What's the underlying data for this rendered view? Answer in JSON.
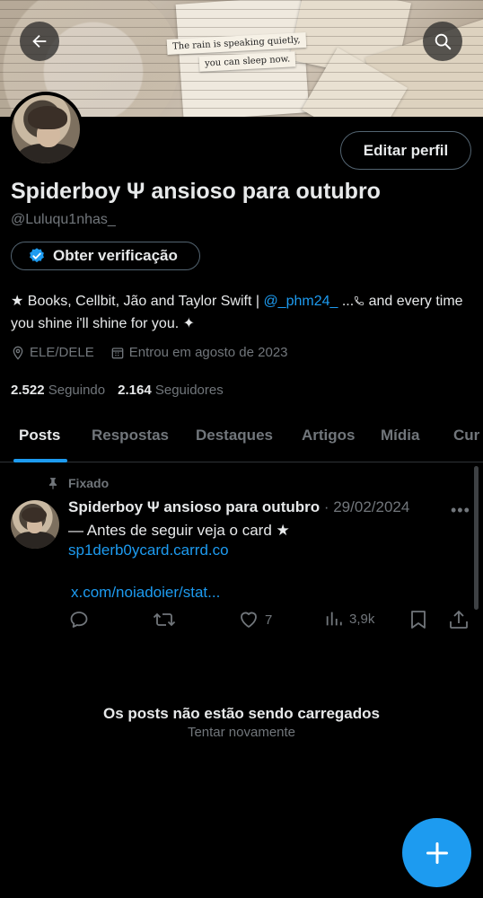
{
  "banner": {
    "quote_line1": "The rain is speaking quietly,",
    "quote_line2": "you can sleep now."
  },
  "header": {
    "edit_profile_label": "Editar perfil"
  },
  "profile": {
    "display_name": "Spiderboy Ψ ansioso para outubro",
    "handle": "@Luluqu1nhas_",
    "verify_label": "Obter verificação",
    "bio_part1": "★ Books, Cellbit, Jão and Taylor Swift | ",
    "bio_mention": "@_phm24_",
    "bio_part2": " ...",
    "bio_part3": " and every time you shine i'll shine for you. ✦",
    "pronouns": "ELE/DELE",
    "joined": "Entrou em agosto de 2023",
    "following_count": "2.522",
    "following_label": "Seguindo",
    "followers_count": "2.164",
    "followers_label": "Seguidores"
  },
  "tabs": [
    {
      "label": "Posts",
      "active": true
    },
    {
      "label": "Respostas"
    },
    {
      "label": "Destaques"
    },
    {
      "label": "Artigos"
    },
    {
      "label": "Mídia"
    },
    {
      "label": "Cur"
    }
  ],
  "post": {
    "pinned_label": "Fixado",
    "author": "Spiderboy Ψ ansioso para outubro",
    "date": " · 29/02/2024",
    "text": "— Antes de seguir veja o card ★",
    "link": "sp1derb0ycard.carrd.co",
    "link2": "x.com/noiadoier/stat...",
    "likes": "7",
    "views": "3,9k"
  },
  "status": {
    "title": "Os posts não estão sendo carregados",
    "retry": "Tentar novamente"
  },
  "colors": {
    "accent": "#1d9bf0",
    "muted": "#71767b",
    "text": "#e7e9ea",
    "background": "#000000"
  },
  "icons": [
    "back-arrow-icon",
    "search-icon",
    "verified-badge-icon",
    "location-icon",
    "calendar-icon",
    "pin-icon",
    "more-icon",
    "reply-icon",
    "repost-icon",
    "like-icon",
    "views-icon",
    "bookmark-icon",
    "share-icon",
    "plus-icon"
  ]
}
